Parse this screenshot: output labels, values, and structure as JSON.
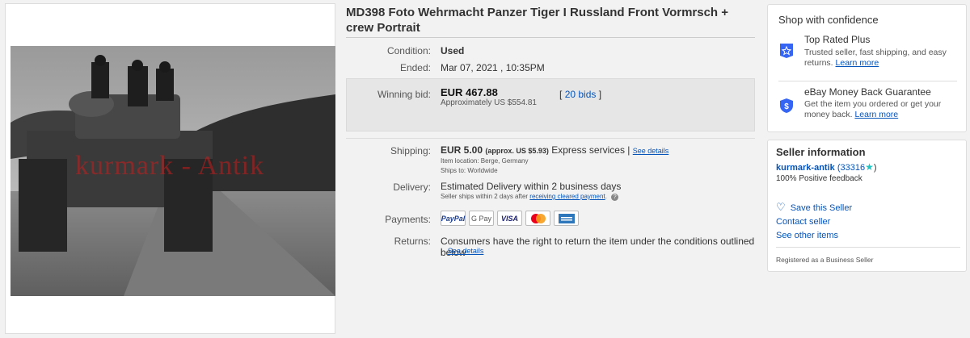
{
  "listing": {
    "title": "MD398 Foto Wehrmacht Panzer Tiger I Russland Front Vormrsch + crew Portrait",
    "watermark": "kurmark - Antik",
    "condition_label": "Condition:",
    "condition_value": "Used",
    "ended_label": "Ended:",
    "ended_value": "Mar 07, 2021 , 10:35PM",
    "winning_bid_label": "Winning bid:",
    "winning_bid_value": "EUR 467.88",
    "approx_value": "Approximately US $554.81",
    "bids_open": "[",
    "bids_link": "20 bids",
    "bids_close": "]",
    "shipping_label": "Shipping:",
    "shipping_value": "EUR 5.00",
    "shipping_approx": "(approx. US $5.93)",
    "shipping_service": "Express services |",
    "shipping_details_link": "See details",
    "item_location": "Item location:  Berge, Germany",
    "ships_to": "Ships to:  Worldwide",
    "delivery_label": "Delivery:",
    "delivery_value": "Estimated Delivery within 2 business days",
    "delivery_note": "Seller ships within 2 days after",
    "delivery_link": "receiving cleared payment",
    "delivery_end": ".",
    "payments_label": "Payments:",
    "payments": [
      "PayPal",
      "G Pay",
      "VISA",
      "",
      ""
    ],
    "returns_label": "Returns:",
    "returns_value": "Consumers have the right to return the item under the conditions outlined below",
    "returns_bar": "|",
    "returns_link": "See details"
  },
  "confidence": {
    "heading": "Shop with confidence",
    "top_rated_title": "Top Rated Plus",
    "top_rated_desc": "Trusted seller, fast shipping, and easy returns.",
    "top_rated_link": "Learn more",
    "mbg_title": "eBay Money Back Guarantee",
    "mbg_desc": "Get the item you ordered or get your money back.",
    "mbg_link": "Learn more"
  },
  "seller": {
    "heading": "Seller information",
    "name": "kurmark-antik",
    "score_open": "(33316",
    "score_close": ")",
    "feedback": "100% Positive feedback",
    "save_link": "Save this Seller",
    "contact_link": "Contact seller",
    "other_items_link": "See other items",
    "business_note": "Registered as a Business Seller"
  },
  "colors": {
    "link": "#0654ba",
    "badge_blue": "#3665f3",
    "star_teal": "#21c4c2"
  }
}
